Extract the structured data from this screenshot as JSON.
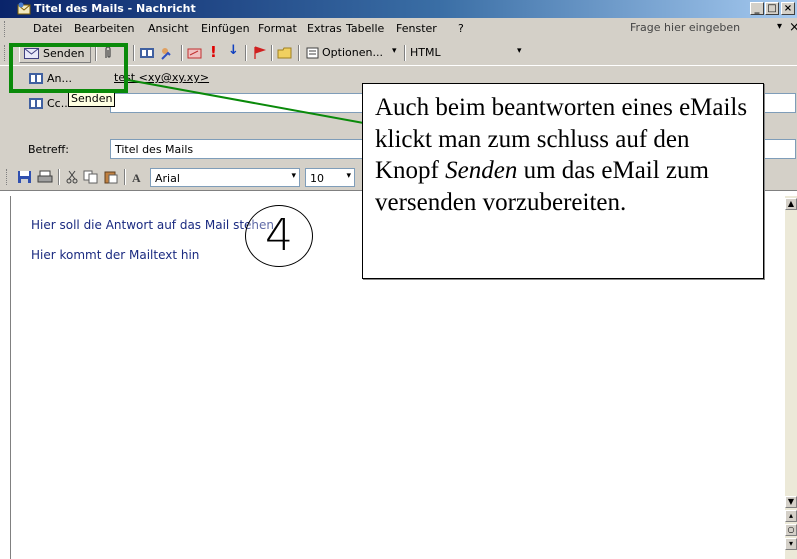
{
  "window": {
    "title": "Titel des Mails - Nachricht",
    "min_glyph": "_",
    "max_glyph": "□",
    "close_glyph": "×"
  },
  "menu": {
    "items": [
      "Datei",
      "Bearbeiten",
      "Ansicht",
      "Einfügen",
      "Format",
      "Extras",
      "Tabelle",
      "Fenster",
      "?"
    ],
    "help_placeholder": "Frage hier eingeben",
    "help_arrow": "▾",
    "help_close": "×"
  },
  "toolbar": {
    "send_label": "Senden",
    "options_label": "Optionen...",
    "options_arrow": "▾",
    "format_value": "HTML",
    "format_arrow": "▾"
  },
  "tooltip": "Senden",
  "headers": {
    "to_label": "An...",
    "to_value": "test <xy@xy.xy>",
    "cc_label": "Cc...",
    "cc_value": "",
    "subject_label": "Betreff:",
    "subject_value": "Titel des Mails"
  },
  "format_toolbar": {
    "font": "Arial",
    "size": "10",
    "select_arrow": "▾"
  },
  "body": {
    "line1": "Hier soll die Antwort auf das Mail stehen",
    "line2": "Hier kommt der Mailtext hin"
  },
  "annotation": {
    "step_number": "4",
    "callout_part1": "Auch beim beantworten eines eMails klickt man zum schluss auf den Knopf",
    "callout_em": "Senden",
    "callout_part2": "um das eMail zum versenden vorzubereiten.",
    "highlight_color": "#0a8a0a"
  },
  "colors": {
    "titlebar": "#0a246a",
    "chrome": "#d4d0c8",
    "body_text": "#1a2a80"
  },
  "icons": [
    "envelope-icon",
    "paperclip-icon",
    "address-book-icon",
    "check-names-icon",
    "importance-high-icon",
    "importance-low-icon",
    "flag-icon",
    "folder-icon",
    "options-icon",
    "save-icon",
    "print-icon",
    "cut-icon",
    "copy-icon",
    "paste-icon"
  ]
}
